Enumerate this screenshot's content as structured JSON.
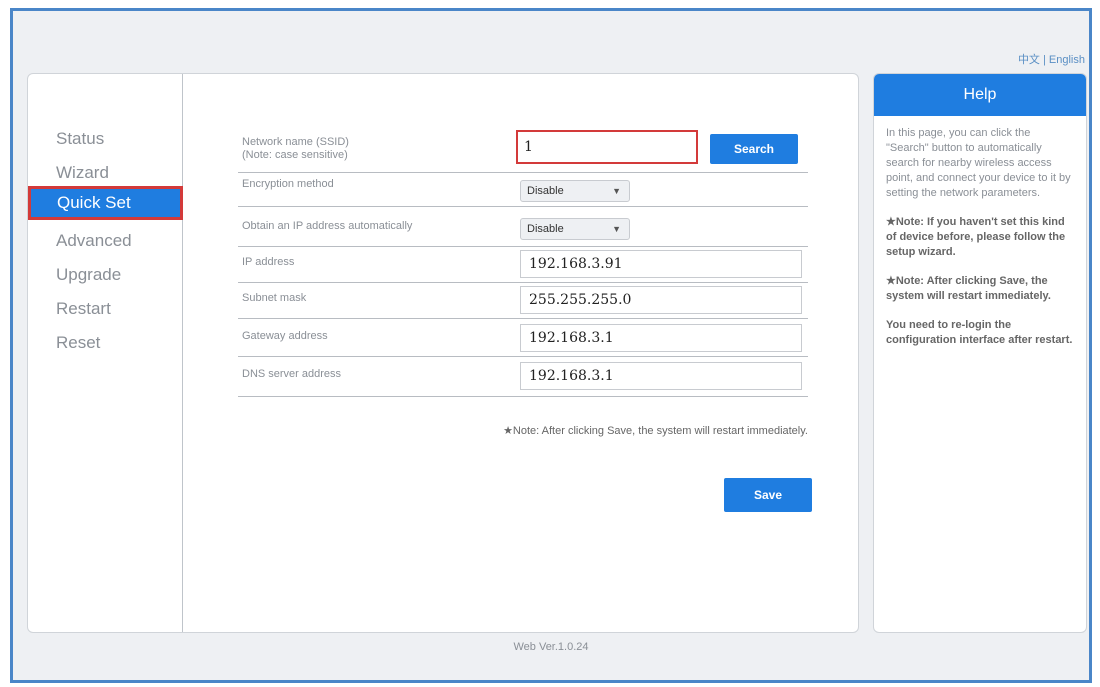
{
  "header": {
    "language": "中文 | English"
  },
  "sidebar": {
    "items": [
      {
        "label": "Status"
      },
      {
        "label": "Wizard"
      },
      {
        "label": "Quick Set",
        "active": true
      },
      {
        "label": "Advanced"
      },
      {
        "label": "Upgrade"
      },
      {
        "label": "Restart"
      },
      {
        "label": "Reset"
      }
    ]
  },
  "form": {
    "ssid": {
      "label_line1": "Network name (SSID)",
      "label_line2": "(Note: case sensitive)",
      "value": "1"
    },
    "search_label": "Search",
    "encryption": {
      "label": "Encryption method",
      "value": "Disable"
    },
    "obtain_ip": {
      "label": "Obtain an IP address automatically",
      "value": "Disable"
    },
    "ip": {
      "label": "IP address",
      "value": "192.168.3.91"
    },
    "subnet": {
      "label": "Subnet mask",
      "value": "255.255.255.0"
    },
    "gateway": {
      "label": "Gateway address",
      "value": "192.168.3.1"
    },
    "dns": {
      "label": "DNS server address",
      "value": "192.168.3.1"
    },
    "note": "★Note: After clicking Save, the system will restart immediately.",
    "save_label": "Save"
  },
  "help": {
    "title": "Help",
    "p1": "In this page, you can click the \"Search\" button to automatically search for nearby wireless access point, and connect your device to it by setting the network parameters.",
    "p2": "★Note: If you haven't set this kind of device before, please follow the setup wizard.",
    "p3": "★Note: After clicking Save, the system will restart immediately.",
    "p4": "You need to re-login the configuration interface after restart."
  },
  "footer": {
    "version": "Web Ver.1.0.24"
  },
  "colors": {
    "accent": "#1f7de0",
    "highlight": "#d33a3a",
    "frame": "#4a86c8"
  }
}
